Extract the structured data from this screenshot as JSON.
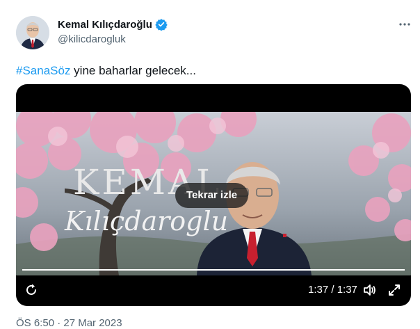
{
  "author": {
    "name": "Kemal Kılıçdaroğlu",
    "handle": "@kilicdarogluk"
  },
  "tweet": {
    "hashtag": "#SanaSöz",
    "text": " yine baharlar gelecek..."
  },
  "video": {
    "overlay_title": "KEMAL",
    "overlay_signature": "Kılıçdaroglu",
    "replay_label": "Tekrar izle",
    "time": "1:37 / 1:37",
    "progress": 1.0
  },
  "meta": {
    "date": "ÖS 6:50 · 27 Mar 2023"
  },
  "colors": {
    "accent": "#1d9bf0",
    "text": "#0f1419",
    "muted": "#536471"
  },
  "icons": {
    "more": "more-horizontal-icon",
    "verified": "verified-badge-icon",
    "replay": "replay-icon",
    "volume": "volume-icon",
    "fullscreen": "fullscreen-icon"
  }
}
